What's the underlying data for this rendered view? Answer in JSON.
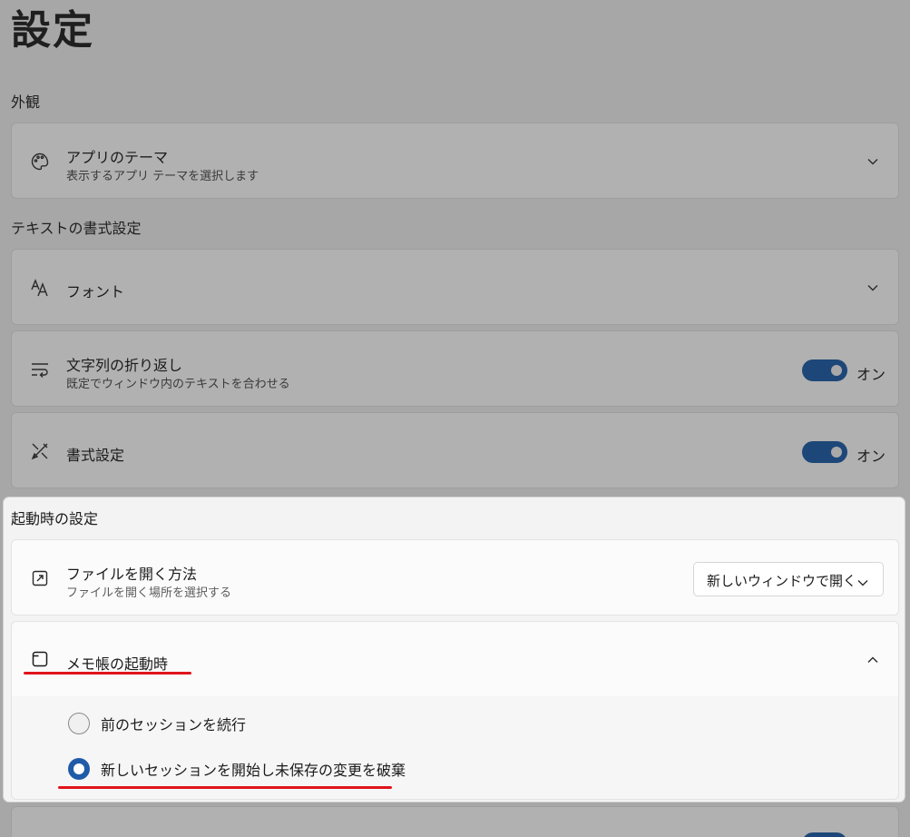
{
  "page": {
    "title": "設定"
  },
  "appearance": {
    "section_label": "外観",
    "theme": {
      "title": "アプリのテーマ",
      "subtitle": "表示するアプリ テーマを選択します"
    }
  },
  "text_formatting": {
    "section_label": "テキストの書式設定",
    "font": {
      "title": "フォント"
    },
    "word_wrap": {
      "title": "文字列の折り返し",
      "subtitle": "既定でウィンドウ内のテキストを合わせる",
      "state": "オン"
    },
    "formatting": {
      "title": "書式設定",
      "state": "オン"
    }
  },
  "startup": {
    "section_label": "起動時の設定",
    "open_file": {
      "title": "ファイルを開く方法",
      "subtitle": "ファイルを開く場所を選択する",
      "selected": "新しいウィンドウで開く"
    },
    "notepad_start": {
      "title": "メモ帳の起動時",
      "options": [
        {
          "label": "前のセッションを続行",
          "checked": false
        },
        {
          "label": "新しいセッションを開始し未保存の変更を破棄",
          "checked": true
        }
      ]
    }
  },
  "colors": {
    "accent": "#1f5ba8",
    "toggle_on": "#1d4778",
    "highlight": "#e0141b"
  }
}
